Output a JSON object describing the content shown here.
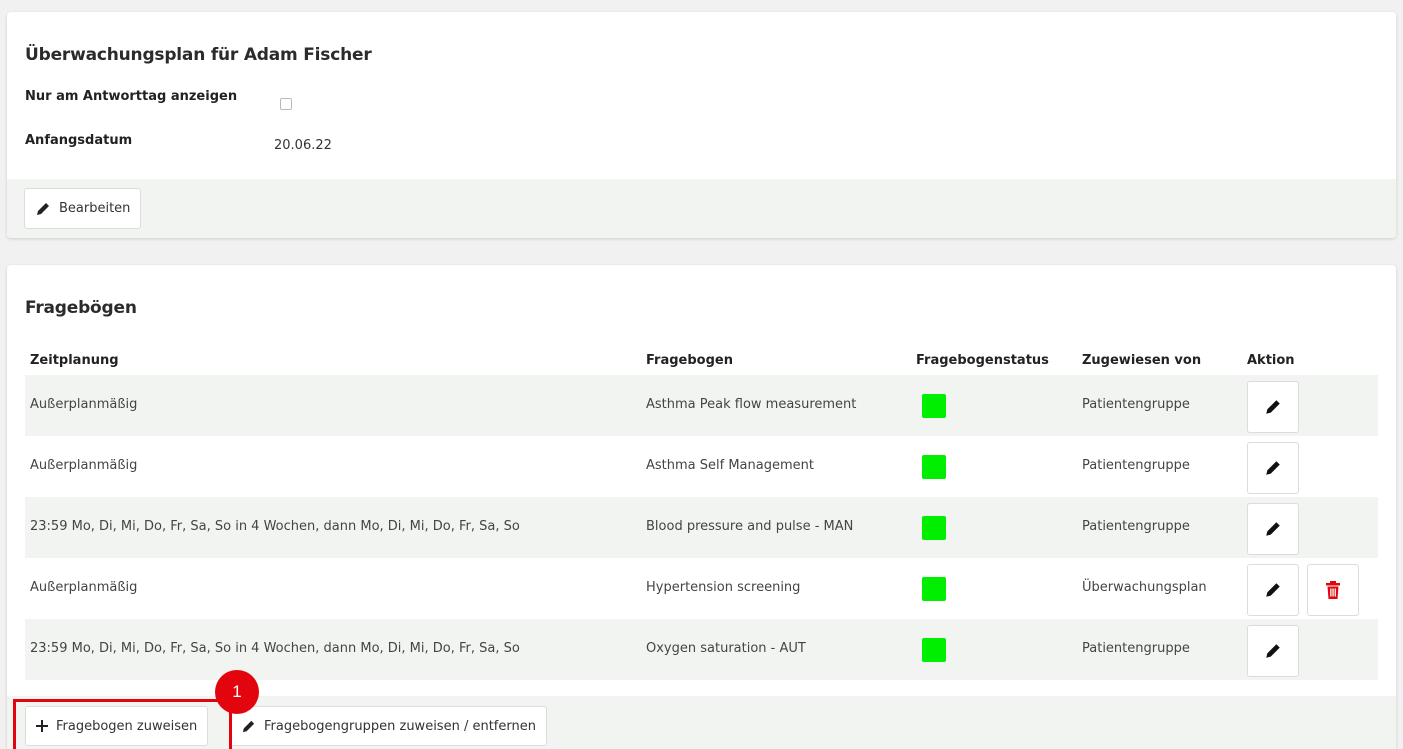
{
  "plan": {
    "title": "Überwachungsplan für Adam Fischer",
    "fields": [
      {
        "label": "Nur am Antworttag anzeigen",
        "type": "checkbox",
        "checked": false
      },
      {
        "label": "Anfangsdatum",
        "value": "20.06.22"
      }
    ],
    "edit_button": {
      "label": "Bearbeiten",
      "icon": "pencil-icon"
    }
  },
  "questionnaires": {
    "title": "Fragebögen",
    "columns": [
      "Zeitplanung",
      "Fragebogen",
      "Fragebogenstatus",
      "Zugewiesen von",
      "Aktion"
    ],
    "rows": [
      {
        "schedule": "Außerplanmäßig",
        "questionnaire": "Asthma Peak flow measurement",
        "status_color": "#00ee00",
        "assigned_by": "Patientengruppe",
        "actions": [
          "edit"
        ]
      },
      {
        "schedule": "Außerplanmäßig",
        "questionnaire": "Asthma Self Management",
        "status_color": "#00ee00",
        "assigned_by": "Patientengruppe",
        "actions": [
          "edit"
        ]
      },
      {
        "schedule": "23:59 Mo, Di, Mi, Do, Fr, Sa, So in 4 Wochen, dann Mo, Di, Mi, Do, Fr, Sa, So",
        "questionnaire": "Blood pressure and pulse - MAN",
        "status_color": "#00ee00",
        "assigned_by": "Patientengruppe",
        "actions": [
          "edit"
        ]
      },
      {
        "schedule": "Außerplanmäßig",
        "questionnaire": "Hypertension screening",
        "status_color": "#00ee00",
        "assigned_by": "Überwachungsplan",
        "actions": [
          "edit",
          "delete"
        ]
      },
      {
        "schedule": "23:59 Mo, Di, Mi, Do, Fr, Sa, So in 4 Wochen, dann Mo, Di, Mi, Do, Fr, Sa, So",
        "questionnaire": "Oxygen saturation - AUT",
        "status_color": "#00ee00",
        "assigned_by": "Patientengruppe",
        "actions": [
          "edit"
        ]
      }
    ],
    "footer": {
      "assign_button": {
        "label": "Fragebogen zuweisen",
        "icon": "plus-icon"
      },
      "groups_button": {
        "label": "Fragebogengruppen zuweisen / entfernen",
        "icon": "pencil-icon"
      }
    }
  },
  "annotation": {
    "marker": "1",
    "color": "#e3050e"
  },
  "colors": {
    "status_ok": "#00ee00",
    "delete_icon": "#e3050e",
    "footer_bg": "#f2f4f2"
  }
}
